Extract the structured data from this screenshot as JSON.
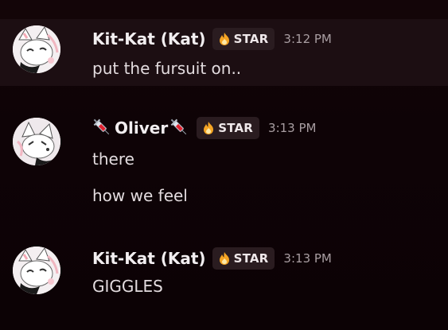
{
  "messages": [
    {
      "author": "Kit-Kat (Kat)",
      "tag": "STAR",
      "time": "3:12 PM",
      "lines": [
        "put the fursuit on.."
      ]
    },
    {
      "author": "Oliver",
      "tag": "STAR",
      "time": "3:13 PM",
      "lines": [
        "there",
        "how we feel"
      ]
    },
    {
      "author": "Kit-Kat (Kat)",
      "tag": "STAR",
      "time": "3:13 PM",
      "lines": [
        "GIGGLES"
      ]
    }
  ],
  "colors": {
    "background": "#120407",
    "highlight_row": "#1c0e12",
    "tag_bg": "#2a1c20",
    "timestamp": "#a99ea2",
    "text": "#e3dcdf",
    "flame_icon": "#f6a623"
  },
  "icons": {
    "tag_icon": "flame-icon",
    "name_decoration": "syringe-icon"
  }
}
